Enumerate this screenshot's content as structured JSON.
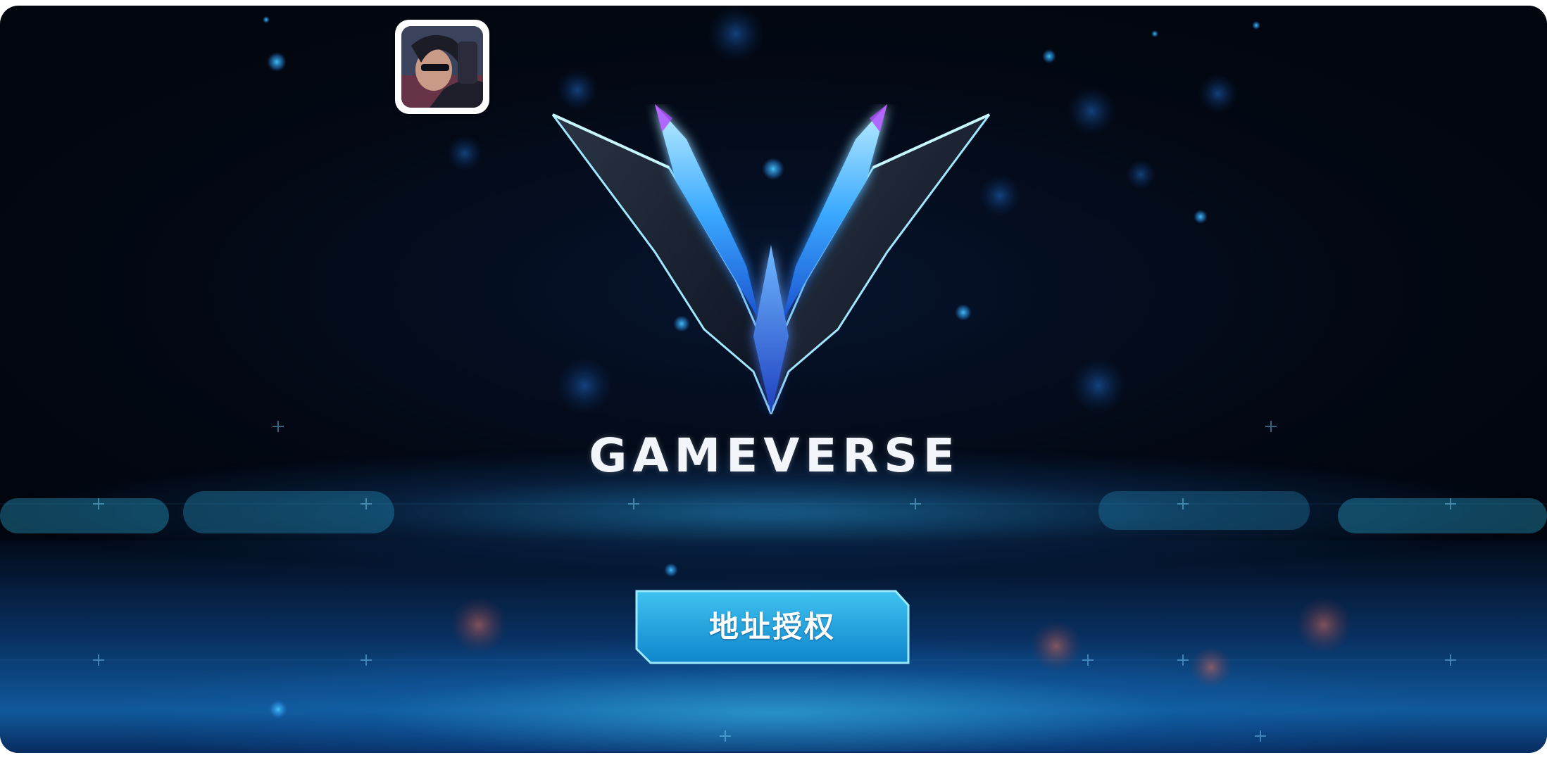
{
  "app": {
    "logo_text": "GAMEVERSE",
    "icon": "app-avatar-icon"
  },
  "auth_button": {
    "label": "地址授权"
  },
  "colors": {
    "background": "#030915",
    "accent_cyan": "#2ec4f0",
    "button_fill": "#1aa3dd",
    "button_border": "#8fe6ff",
    "emblem_blue": "#3a8bff"
  }
}
